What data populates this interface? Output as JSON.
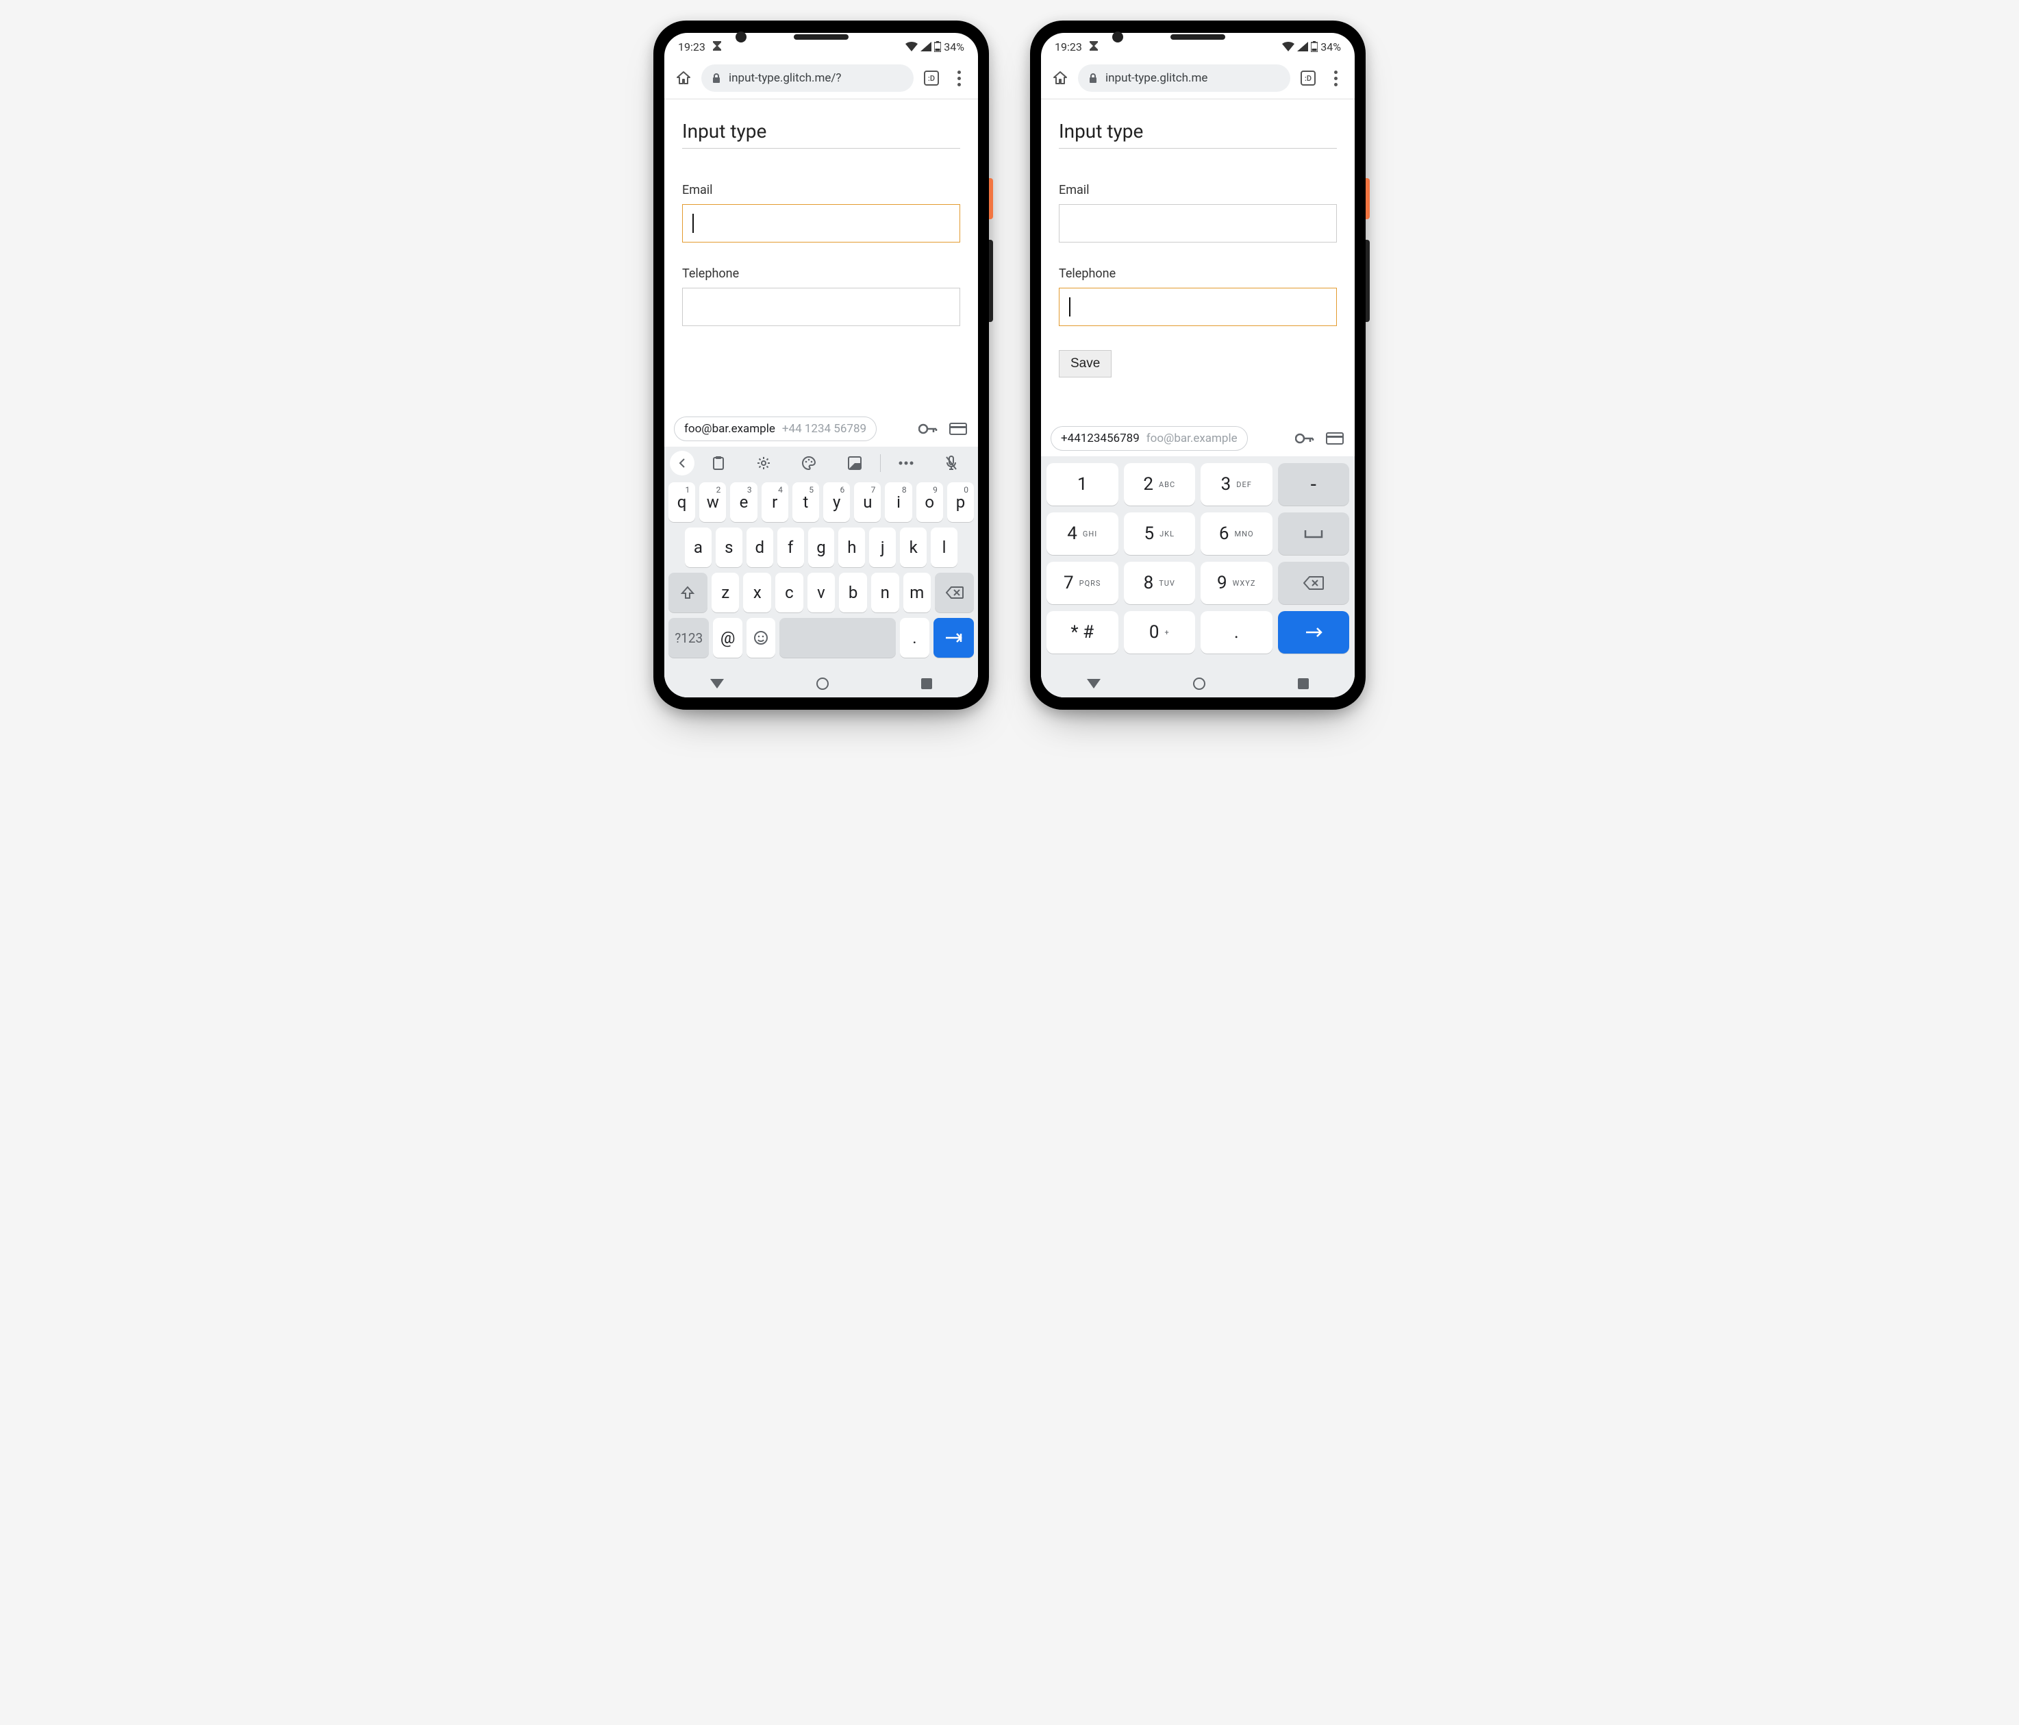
{
  "status": {
    "time": "19:23",
    "battery": "34%"
  },
  "browser": {
    "url_left": "input-type.glitch.me/?",
    "url_right": "input-type.glitch.me",
    "tab_badge": ":D"
  },
  "page": {
    "title": "Input type",
    "email_label": "Email",
    "tel_label": "Telephone",
    "save_label": "Save"
  },
  "autofill": {
    "email_suggestion": "foo@bar.example",
    "phone_suggestion_spaced": "+44 1234 56789",
    "phone_suggestion_compact": "+44123456789"
  },
  "qwerty": {
    "row1": [
      {
        "k": "q",
        "s": "1"
      },
      {
        "k": "w",
        "s": "2"
      },
      {
        "k": "e",
        "s": "3"
      },
      {
        "k": "r",
        "s": "4"
      },
      {
        "k": "t",
        "s": "5"
      },
      {
        "k": "y",
        "s": "6"
      },
      {
        "k": "u",
        "s": "7"
      },
      {
        "k": "i",
        "s": "8"
      },
      {
        "k": "o",
        "s": "9"
      },
      {
        "k": "p",
        "s": "0"
      }
    ],
    "row2": [
      "a",
      "s",
      "d",
      "f",
      "g",
      "h",
      "j",
      "k",
      "l"
    ],
    "row3": [
      "z",
      "x",
      "c",
      "v",
      "b",
      "n",
      "m"
    ],
    "sym_key": "?123",
    "at_key": "@",
    "period_key": "."
  },
  "numpad": {
    "keys": [
      [
        {
          "n": "1",
          "s": ""
        },
        {
          "n": "2",
          "s": "ABC"
        },
        {
          "n": "3",
          "s": "DEF"
        },
        {
          "op": "-"
        }
      ],
      [
        {
          "n": "4",
          "s": "GHI"
        },
        {
          "n": "5",
          "s": "JKL"
        },
        {
          "n": "6",
          "s": "MNO"
        },
        {
          "op": "␣"
        }
      ],
      [
        {
          "n": "7",
          "s": "PQRS"
        },
        {
          "n": "8",
          "s": "TUV"
        },
        {
          "n": "9",
          "s": "WXYZ"
        },
        {
          "op": "bksp"
        }
      ],
      [
        {
          "n": "* #",
          "s": ""
        },
        {
          "n": "0",
          "s": "+"
        },
        {
          "n": ".",
          "s": ""
        },
        {
          "op": "enter"
        }
      ]
    ]
  }
}
